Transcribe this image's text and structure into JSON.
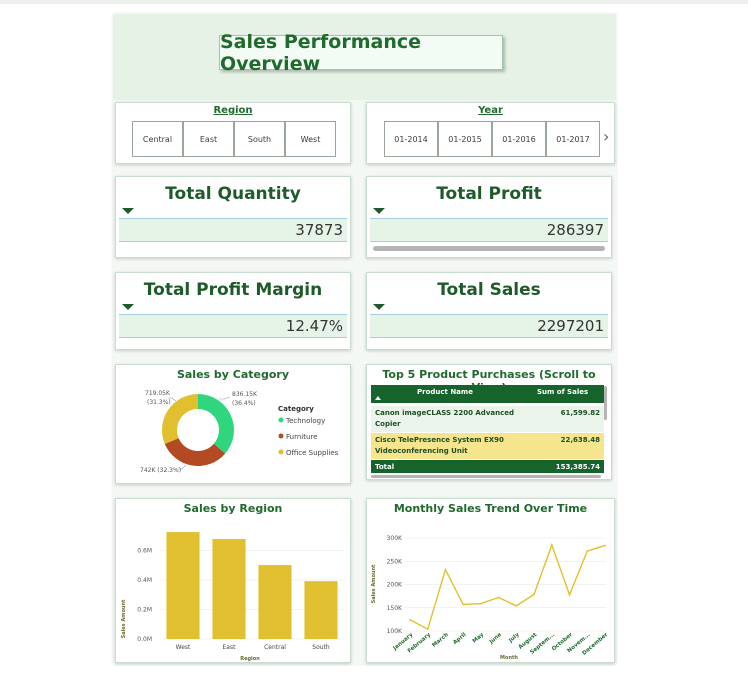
{
  "title": "Sales Performance Overview",
  "slicers": {
    "region": {
      "label": "Region",
      "options": [
        "Central",
        "East",
        "South",
        "West"
      ]
    },
    "year": {
      "label": "Year",
      "options": [
        "01-2014",
        "01-2015",
        "01-2016",
        "01-2017"
      ],
      "next_glyph": "›"
    }
  },
  "kpis": {
    "total_quantity": {
      "label": "Total Quantity",
      "value": "37873"
    },
    "total_profit": {
      "label": "Total Profit",
      "value": "286397"
    },
    "total_profit_margin": {
      "label": "Total Profit Margin",
      "value": "12.47%"
    },
    "total_sales": {
      "label": "Total Sales",
      "value": "2297201"
    }
  },
  "top_products": {
    "title": "Top 5 Product Purchases (Scroll to View)",
    "columns": [
      "Product Name",
      "Sum of Sales"
    ],
    "rows": [
      {
        "name_line1": "Canon imageCLASS 2200 Advanced",
        "name_line2": "Copier",
        "sales": "61,599.82"
      },
      {
        "name_line1": "Cisco TelePresence System EX90",
        "name_line2": "Videoconferencing Unit",
        "sales": "22,638.48"
      }
    ],
    "total_label": "Total",
    "total_value": "153,385.74"
  },
  "colors": {
    "technology": "#2fd67e",
    "furniture": "#b34a24",
    "office_supplies": "#e1c030",
    "bar": "#e1c030",
    "line": "#e1c030",
    "header_green": "#16632b"
  },
  "chart_data": [
    {
      "type": "pie",
      "title": "Sales by Category",
      "legend_title": "Category",
      "legend_position": "right",
      "categories": [
        "Technology",
        "Furniture",
        "Office Supplies"
      ],
      "values": [
        836150,
        742000,
        719050
      ],
      "labels": [
        {
          "value": "836.15K",
          "pct": "(36.4%)"
        },
        {
          "value": "742K (32.3%)",
          "pct": ""
        },
        {
          "value": "719.05K",
          "pct": "(31.3%)"
        }
      ]
    },
    {
      "type": "bar",
      "title": "Sales by Region",
      "xlabel": "Region",
      "ylabel": "Sales Amount",
      "categories": [
        "West",
        "East",
        "Central",
        "South"
      ],
      "values": [
        725000,
        678000,
        501000,
        392000
      ],
      "ylim": [
        0,
        800000
      ],
      "yticks": [
        0,
        200000,
        400000,
        600000
      ],
      "ytick_labels": [
        "0.0M",
        "0.2M",
        "0.4M",
        "0.6M"
      ]
    },
    {
      "type": "line",
      "title": "Monthly Sales Trend Over Time",
      "xlabel": "Month",
      "ylabel": "Sales Amount",
      "categories": [
        "January",
        "February",
        "March",
        "April",
        "May",
        "June",
        "July",
        "August",
        "Septem...",
        "October",
        "Novem...",
        "December"
      ],
      "values": [
        124000,
        104000,
        232000,
        157000,
        159000,
        172000,
        154000,
        179000,
        285000,
        178000,
        272000,
        284000
      ],
      "ylim": [
        100000,
        300000
      ],
      "yticks": [
        100000,
        150000,
        200000,
        250000,
        300000
      ],
      "ytick_labels": [
        "100K",
        "150K",
        "200K",
        "250K",
        "300K"
      ]
    }
  ]
}
